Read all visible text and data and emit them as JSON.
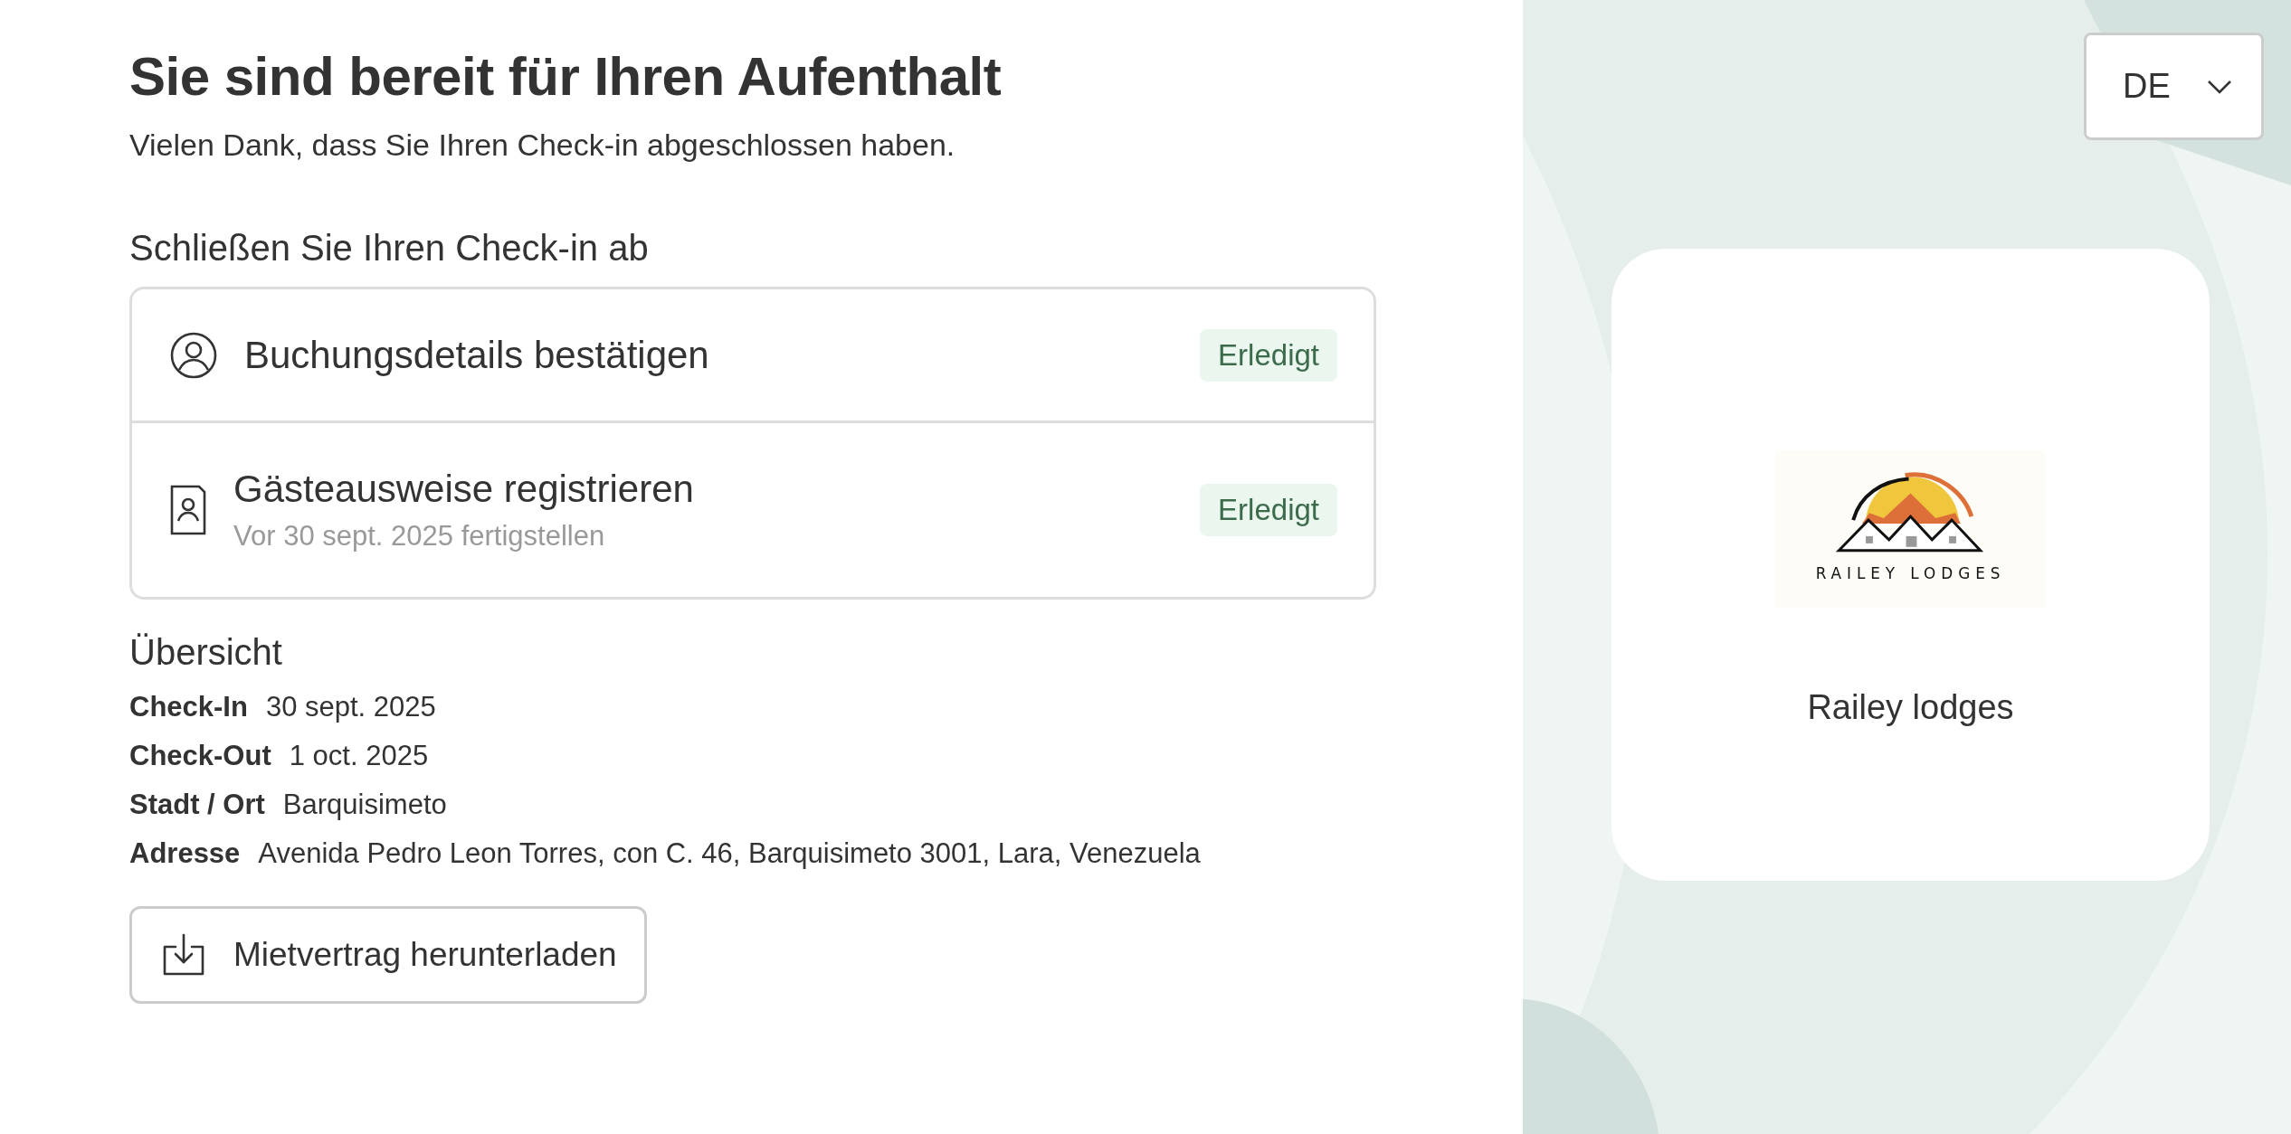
{
  "header": {
    "title": "Sie sind bereit für Ihren Aufenthalt",
    "subtitle": "Vielen Dank, dass Sie Ihren Check-in abgeschlossen haben."
  },
  "language_select": {
    "value": "DE"
  },
  "checkin": {
    "heading": "Schließen Sie Ihren Check-in ab",
    "steps": [
      {
        "kind": "booking",
        "title": "Buchungsdetails bestätigen",
        "badge": "Erledigt"
      },
      {
        "kind": "guest_ids",
        "title": "Gästeausweise registrieren",
        "note": "Vor 30 sept. 2025 fertigstellen",
        "badge": "Erledigt"
      }
    ]
  },
  "overview": {
    "heading": "Übersicht",
    "rows": [
      {
        "label": "Check-In",
        "value": "30 sept. 2025"
      },
      {
        "label": "Check-Out",
        "value": "1 oct. 2025"
      },
      {
        "label": "Stadt / Ort",
        "value": "Barquisimeto"
      },
      {
        "label": "Adresse",
        "value": "Avenida Pedro Leon Torres, con C. 46, Barquisimeto 3001, Lara, Venezuela"
      }
    ]
  },
  "download_button": {
    "label": "Mietvertrag herunterladen"
  },
  "property": {
    "logo_text": "RAILEY LODGES",
    "name": "Railey lodges"
  }
}
